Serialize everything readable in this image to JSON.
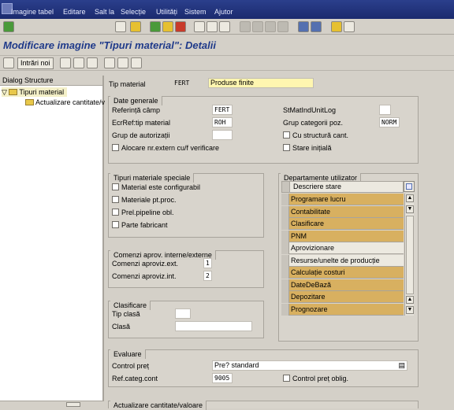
{
  "menu": [
    "Imagine tabel",
    "Editare",
    "Salt la",
    "Selecție",
    "Utilități",
    "Sistem",
    "Ajutor"
  ],
  "title": "Modificare imagine \"Tipuri material\": Detalii",
  "toolbar2": {
    "new_entries": "Intrări noi"
  },
  "tree": {
    "header": "Dialog Structure",
    "root": "Tipuri material",
    "child": "Actualizare cantitate/v"
  },
  "tip_material": {
    "label": "Tip material",
    "code": "FERT",
    "desc": "Produse finite"
  },
  "date_generale": {
    "title": "Date generale",
    "ref_camp_label": "Referință câmp",
    "ref_camp": "FERT",
    "ecr_ref_label": "EcrRef:tip material",
    "ecr_ref": "ROH",
    "grup_aut_label": "Grup de autorizații",
    "alocare_label": "Alocare nr.extern cu/f verificare",
    "stmat_label": "StMatIndUnitLog",
    "grup_categ_label": "Grup categorii poz.",
    "grup_categ": "NORM",
    "cu_structura_label": "Cu structură cant.",
    "stare_label": "Stare inițială"
  },
  "tipuri_speciale": {
    "title": "Tipuri materiale speciale",
    "items": [
      "Material este configurabil",
      "Materiale pt.proc.",
      "Prel.pipeline obl.",
      "Parte fabricant"
    ]
  },
  "comenzi": {
    "title": "Comenzi aprov. interne/externe",
    "ext_label": "Comenzi aproviz.ext.",
    "ext": "1",
    "int_label": "Comenzi aproviz.int.",
    "int": "2"
  },
  "clasificare": {
    "title": "Clasificare",
    "tip_clasa_label": "Tip clasă",
    "clasa_label": "Clasă"
  },
  "departamente": {
    "title": "Departamente utilizator",
    "col": "Descriere stare",
    "rows": [
      "Programare lucru",
      "Contabilitate",
      "Clasificare",
      "PNM",
      "Aprovizionare",
      "Resurse/unelte de producție",
      "Calculație costuri",
      "DateDeBază",
      "Depozitare",
      "Prognozare"
    ],
    "highlighted": [
      true,
      true,
      true,
      true,
      false,
      false,
      true,
      true,
      true,
      true
    ]
  },
  "evaluare": {
    "title": "Evaluare",
    "control_label": "Control preț",
    "control": "Pre? standard",
    "ref_label": "Ref.categ.cont",
    "ref": "9005",
    "oblig_label": "Control preț oblig."
  },
  "bottom": {
    "title": "Actualizare cantitate/valoare"
  },
  "colors": {
    "highlight": "#d8b060",
    "menubar": "#1b2a6e",
    "title": "#1f3a8a"
  }
}
